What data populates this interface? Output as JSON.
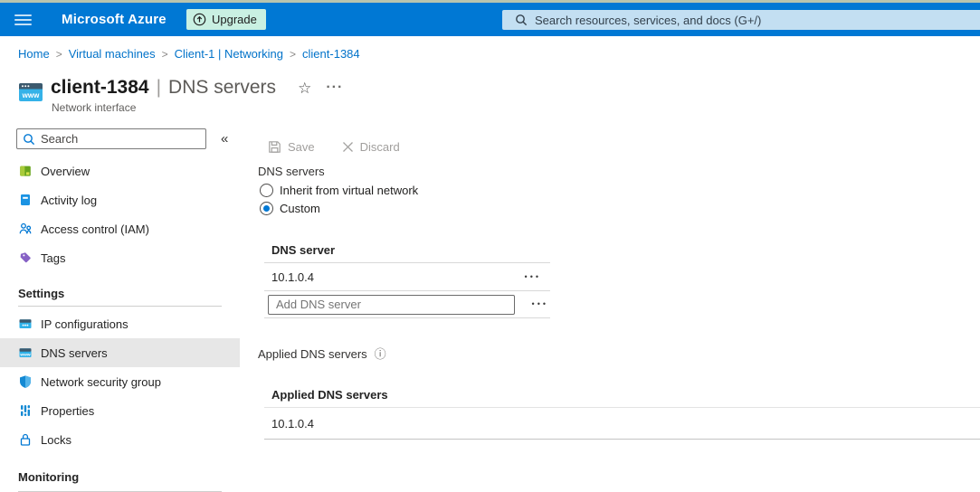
{
  "topbar": {
    "brand": "Microsoft Azure",
    "upgrade_label": "Upgrade",
    "search_placeholder": "Search resources, services, and docs (G+/)"
  },
  "breadcrumb": {
    "items": [
      "Home",
      "Virtual machines",
      "Client-1 | Networking",
      "client-1384"
    ]
  },
  "page_header": {
    "title": "client-1384",
    "separator": "|",
    "section": "DNS servers",
    "subtitle": "Network interface"
  },
  "sidebar": {
    "search_placeholder": "Search",
    "items_top": [
      {
        "label": "Overview"
      },
      {
        "label": "Activity log"
      },
      {
        "label": "Access control (IAM)"
      },
      {
        "label": "Tags"
      }
    ],
    "settings_header": "Settings",
    "settings_items": [
      {
        "label": "IP configurations"
      },
      {
        "label": "DNS servers",
        "selected": true
      },
      {
        "label": "Network security group"
      },
      {
        "label": "Properties"
      },
      {
        "label": "Locks"
      }
    ],
    "monitoring_header": "Monitoring"
  },
  "main": {
    "toolbar": {
      "save_label": "Save",
      "discard_label": "Discard"
    },
    "dns_group_label": "DNS servers",
    "radio_inherit": "Inherit from virtual network",
    "radio_custom": "Custom",
    "dns_table": {
      "header": "DNS server",
      "row_value": "10.1.0.4",
      "add_placeholder": "Add DNS server"
    },
    "applied": {
      "label": "Applied DNS servers",
      "table_header": "Applied DNS servers",
      "row_value": "10.1.0.4"
    }
  },
  "icons": {
    "collapse": "«",
    "star": "☆",
    "more": "···",
    "info": "ⓘ",
    "breadcrumb_separator": ">",
    "row_menu": "•••"
  },
  "colors": {
    "header_blue": "#0078d4",
    "upgrade_bg": "#c9f0e2",
    "topbar_search_bg": "#c3dff2",
    "link_blue": "#0072c9",
    "selected_item_bg": "#e7e7e7",
    "accent_blue": "#0078d4"
  }
}
